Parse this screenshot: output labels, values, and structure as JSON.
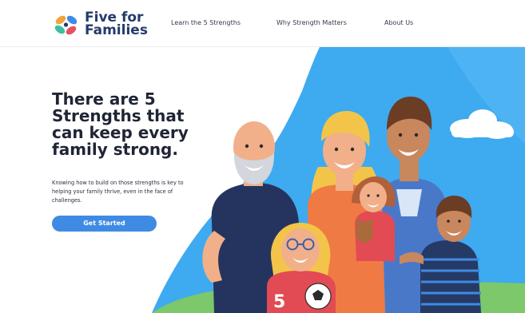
{
  "brand": {
    "name_line1": "Five for",
    "name_line2": "Families",
    "logo_colors": [
      "#f2a33a",
      "#3f8be4",
      "#e7515f",
      "#3fbfa0"
    ],
    "text_color": "#243b6b"
  },
  "nav": {
    "items": [
      {
        "label": "Learn the 5 Strengths"
      },
      {
        "label": "Why Strength Matters"
      },
      {
        "label": "About Us"
      }
    ]
  },
  "hero": {
    "headline": "There are 5 Strengths that can keep every family strong.",
    "subtext": "Knowing how to build on those strengths is key to helping your family thrive, even in the face of challenges.",
    "cta_label": "Get Started",
    "accent_color": "#3f8be4",
    "illustration": {
      "subject": "family-illustration",
      "shirt_number": "5"
    }
  }
}
